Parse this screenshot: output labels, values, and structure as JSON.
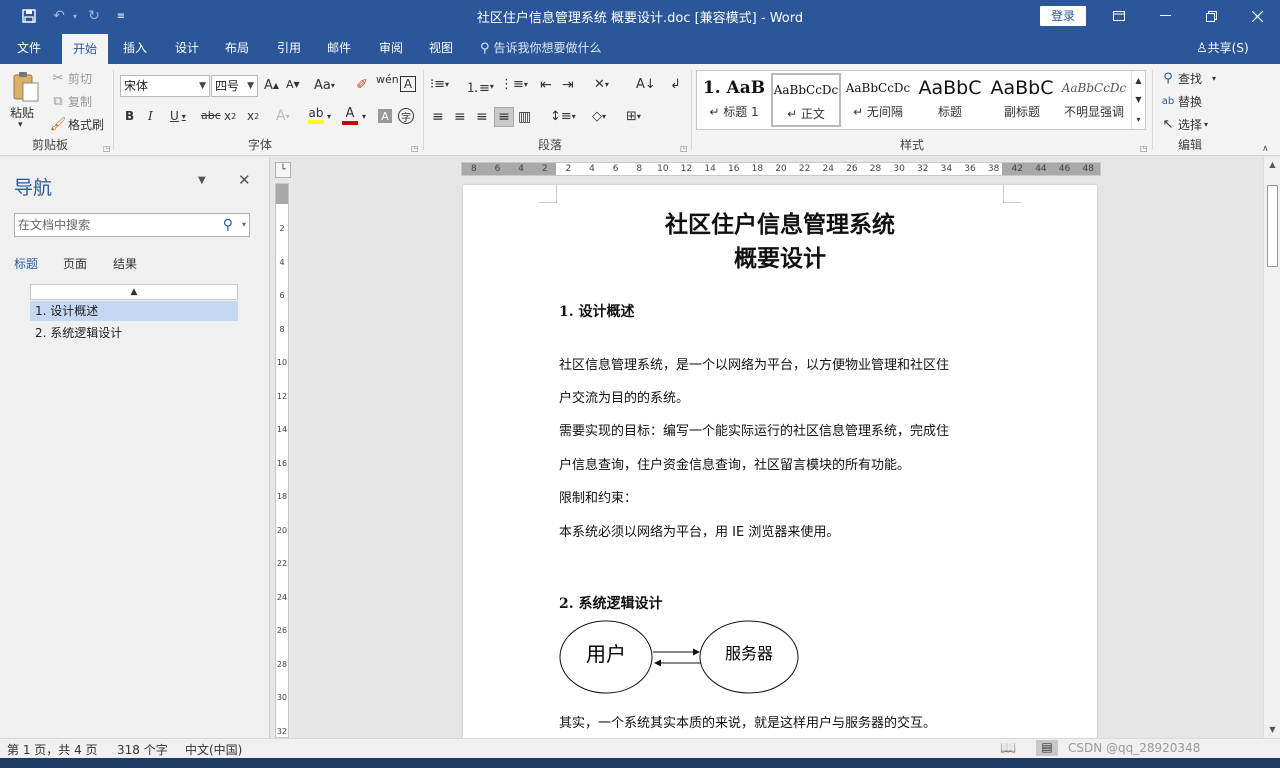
{
  "window": {
    "title": "社区住户信息管理系统 概要设计.doc [兼容模式] - Word",
    "login": "登录"
  },
  "tabs": [
    "文件",
    "开始",
    "插入",
    "设计",
    "布局",
    "引用",
    "邮件",
    "审阅",
    "视图"
  ],
  "active_tab": "开始",
  "tell_me": "告诉我你想要做什么",
  "share": "共享(S)",
  "ribbon": {
    "clipboard": {
      "paste": "粘贴",
      "cut": "剪切",
      "copy": "复制",
      "format_painter": "格式刷",
      "label": "剪贴板"
    },
    "font": {
      "font_name": "宋体",
      "font_size": "四号",
      "label": "字体"
    },
    "paragraph": {
      "label": "段落"
    },
    "styles": {
      "items": [
        {
          "preview": "1.  AaB",
          "name": "↵ 标题 1"
        },
        {
          "preview": "AaBbCcDc",
          "name": "↵ 正文"
        },
        {
          "preview": "AaBbCcDc",
          "name": "↵ 无间隔"
        },
        {
          "preview": "AaBbC",
          "name": "标题"
        },
        {
          "preview": "AaBbC",
          "name": "副标题"
        },
        {
          "preview": "AaBbCcDc",
          "name": "不明显强调"
        }
      ],
      "selected": 1,
      "label": "样式"
    },
    "editing": {
      "find": "查找",
      "replace": "替换",
      "select": "选择",
      "label": "编辑"
    }
  },
  "nav": {
    "title": "导航",
    "search_placeholder": "在文档中搜索",
    "tabs": [
      "标题",
      "页面",
      "结果"
    ],
    "active_tab": "标题",
    "headings": [
      "1.  设计概述",
      "2.  系统逻辑设计"
    ],
    "selected_heading": 0
  },
  "hruler_labels": [
    "8",
    "6",
    "4",
    "2",
    "2",
    "4",
    "6",
    "8",
    "10",
    "12",
    "14",
    "16",
    "18",
    "20",
    "22",
    "24",
    "26",
    "28",
    "30",
    "32",
    "34",
    "36",
    "38",
    "42",
    "44",
    "46",
    "48"
  ],
  "vruler_labels": [
    "2",
    "4",
    "6",
    "8",
    "10",
    "12",
    "14",
    "16",
    "18",
    "20",
    "22",
    "24",
    "26",
    "28",
    "30",
    "32"
  ],
  "document": {
    "title_line1": "社区住户信息管理系统",
    "title_line2": "概要设计",
    "heading1": "1. 设计概述",
    "paragraphs": [
      "社区信息管理系统，是一个以网络为平台，以方便物业管理和社区住",
      "户交流为目的的系统。",
      "需要实现的目标：编写一个能实际运行的社区信息管理系统，完成住",
      "户信息查询，住户资金信息查询，社区留言模块的所有功能。",
      "限制和约束：",
      "本系统必须以网络为平台，用 IE 浏览器来使用。"
    ],
    "heading2": "2. 系统逻辑设计",
    "diagram": {
      "left": "用户",
      "right": "服务器"
    },
    "closing": "其实，一个系统其实本质的来说，就是这样用户与服务器的交互。"
  },
  "status": {
    "page": "第 1 页，共 4 页",
    "words": "318 个字",
    "language": "中文(中国)",
    "watermark": "CSDN @qq_28920348"
  }
}
